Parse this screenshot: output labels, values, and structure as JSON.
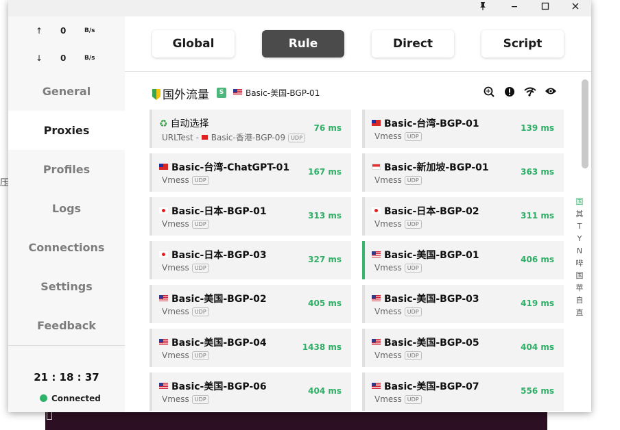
{
  "background": {
    "left_text": "压的"
  },
  "titlebar": {
    "pin_icon": "pin-icon",
    "minimize_icon": "minimize-icon",
    "maximize_icon": "maximize-icon",
    "close_icon": "close-icon"
  },
  "traffic": {
    "up": {
      "arrow": "↑",
      "value": "0",
      "unit": "B/s"
    },
    "down": {
      "arrow": "↓",
      "value": "0",
      "unit": "B/s"
    }
  },
  "nav": {
    "items": [
      {
        "label": "General"
      },
      {
        "label": "Proxies"
      },
      {
        "label": "Profiles"
      },
      {
        "label": "Logs"
      },
      {
        "label": "Connections"
      },
      {
        "label": "Settings"
      },
      {
        "label": "Feedback"
      }
    ],
    "active": "Proxies"
  },
  "footer": {
    "clock": "21 : 18 : 37",
    "status": "Connected",
    "status_color": "#2fb36b"
  },
  "modes": {
    "buttons": [
      {
        "label": "Global"
      },
      {
        "label": "Rule"
      },
      {
        "label": "Direct"
      },
      {
        "label": "Script"
      }
    ],
    "active": "Rule"
  },
  "group": {
    "title": "国外流量",
    "badge": "S",
    "selected": "Basic-美国-BGP-01",
    "icons": [
      "network-search-icon",
      "alert-icon",
      "wifi-test-icon",
      "eye-icon"
    ]
  },
  "proxies": [
    {
      "name": "自动选择",
      "flag": "recycle",
      "type": "URLTest - ",
      "sub": "Basic-香港-BGP-09",
      "sub_flag": "hk",
      "udp": "UDP",
      "delay": "76 ms"
    },
    {
      "name": "Basic-台湾-BGP-01",
      "flag": "tw",
      "type": "Vmess",
      "udp": "UDP",
      "delay": "139 ms"
    },
    {
      "name": "Basic-台湾-ChatGPT-01",
      "flag": "tw",
      "type": "Vmess",
      "udp": "UDP",
      "delay": "167 ms"
    },
    {
      "name": "Basic-新加坡-BGP-01",
      "flag": "sg",
      "type": "Vmess",
      "udp": "UDP",
      "delay": "363 ms"
    },
    {
      "name": "Basic-日本-BGP-01",
      "flag": "jp",
      "type": "Vmess",
      "udp": "UDP",
      "delay": "313 ms"
    },
    {
      "name": "Basic-日本-BGP-02",
      "flag": "jp",
      "type": "Vmess",
      "udp": "UDP",
      "delay": "311 ms"
    },
    {
      "name": "Basic-日本-BGP-03",
      "flag": "jp",
      "type": "Vmess",
      "udp": "UDP",
      "delay": "327 ms"
    },
    {
      "name": "Basic-美国-BGP-01",
      "flag": "us",
      "type": "Vmess",
      "udp": "UDP",
      "delay": "406 ms",
      "selected": true
    },
    {
      "name": "Basic-美国-BGP-02",
      "flag": "us",
      "type": "Vmess",
      "udp": "UDP",
      "delay": "405 ms"
    },
    {
      "name": "Basic-美国-BGP-03",
      "flag": "us",
      "type": "Vmess",
      "udp": "UDP",
      "delay": "419 ms"
    },
    {
      "name": "Basic-美国-BGP-04",
      "flag": "us",
      "type": "Vmess",
      "udp": "UDP",
      "delay": "1438 ms"
    },
    {
      "name": "Basic-美国-BGP-05",
      "flag": "us",
      "type": "Vmess",
      "udp": "UDP",
      "delay": "404 ms"
    },
    {
      "name": "Basic-美国-BGP-06",
      "flag": "us",
      "type": "Vmess",
      "udp": "UDP",
      "delay": "404 ms"
    },
    {
      "name": "Basic-美国-BGP-07",
      "flag": "us",
      "type": "Vmess",
      "udp": "UDP",
      "delay": "556 ms"
    }
  ],
  "index_letters": [
    "国",
    "其",
    "T",
    "Y",
    "N",
    "哔",
    "国",
    "苹",
    "自",
    "直"
  ],
  "accent_color": "#2fae66"
}
